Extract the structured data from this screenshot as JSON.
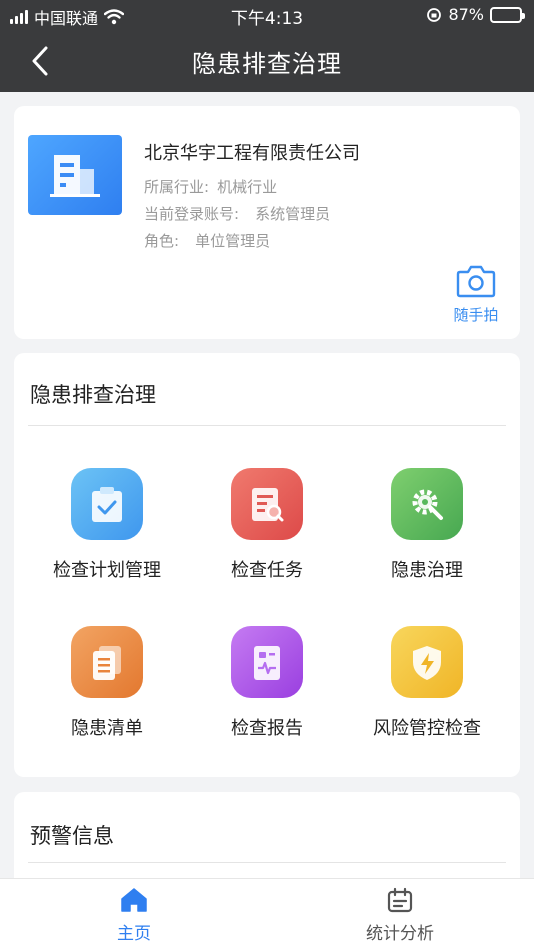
{
  "status_bar": {
    "carrier": "中国联通",
    "time": "下午4:13",
    "battery": "87%",
    "battery_level": 0.87
  },
  "nav": {
    "title": "隐患排查治理",
    "back_icon": "chevron-left-icon"
  },
  "company": {
    "name": "北京华宇工程有限责任公司",
    "industry_label": "所属行业:",
    "industry_value": "机械行业",
    "account_label": "当前登录账号:",
    "account_value": "系统管理员",
    "role_label": "角色:",
    "role_value": "单位管理员",
    "snap_label": "随手拍"
  },
  "module": {
    "title": "隐患排查治理",
    "items": [
      {
        "label": "检查计划管理",
        "icon": "clipboard-check-icon",
        "color": "#4aa8f0"
      },
      {
        "label": "检查任务",
        "icon": "document-search-icon",
        "color": "#e8534f"
      },
      {
        "label": "隐患治理",
        "icon": "gear-wrench-icon",
        "color": "#57b85c"
      },
      {
        "label": "隐患清单",
        "icon": "documents-icon",
        "color": "#e9843c"
      },
      {
        "label": "检查报告",
        "icon": "report-icon",
        "color": "#a248e6"
      },
      {
        "label": "风险管控检查",
        "icon": "shield-bolt-icon",
        "color": "#f4c23a"
      }
    ]
  },
  "warning": {
    "title": "预警信息"
  },
  "tabbar": {
    "home": {
      "label": "主页",
      "color": "#2f7ff0"
    },
    "stats": {
      "label": "统计分析",
      "color": "#555555"
    }
  }
}
